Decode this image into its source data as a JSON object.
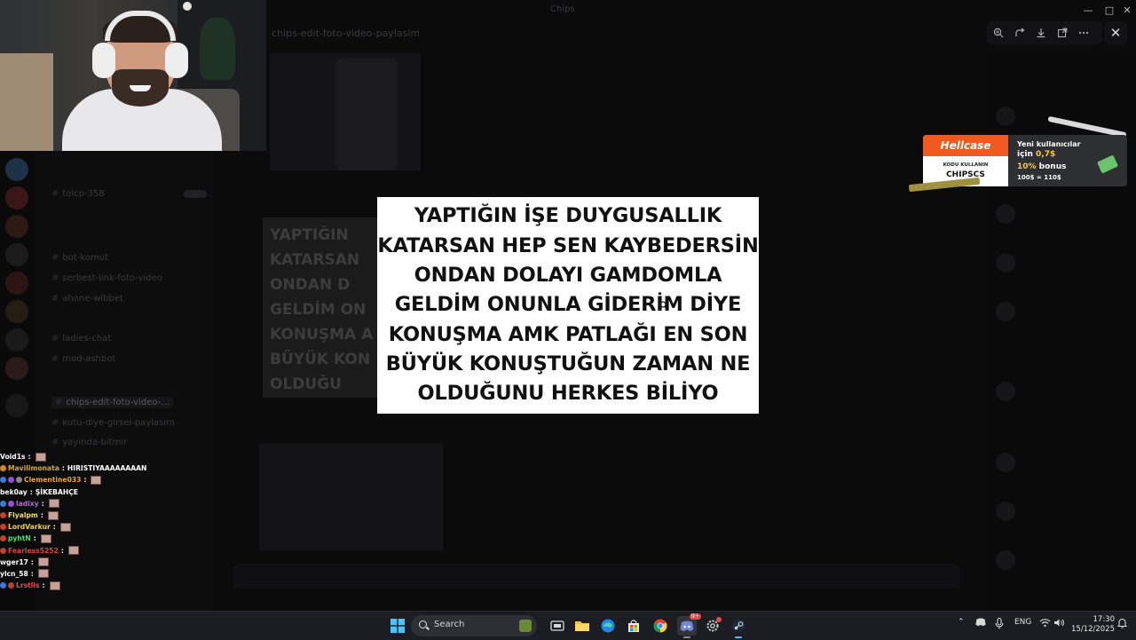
{
  "window": {
    "title": "Chips",
    "minimize_glyph": "—",
    "maximize_glyph": "□",
    "close_glyph": "✕"
  },
  "background_app": {
    "channel_header": "chips-edit-foto-video-paylasim",
    "channels": [
      {
        "label": "tolcp-358",
        "icon": "hash-icon"
      },
      {
        "label": "bot-komut",
        "icon": "hash-icon"
      },
      {
        "label": "serbest-link-foto-video",
        "icon": "hash-icon"
      },
      {
        "label": "ahone-wibbet",
        "icon": "hash-icon"
      },
      {
        "label": "ladies-chat",
        "icon": "hash-icon"
      },
      {
        "label": "mod-ashbot",
        "icon": "hash-icon"
      },
      {
        "label": "chips-edit-foto-video-...",
        "icon": "hash-icon",
        "active": true
      },
      {
        "label": "kutu-diye-girsel-paylasim",
        "icon": "hash-icon"
      },
      {
        "label": "yayinda-bitmir",
        "icon": "hash-icon"
      }
    ],
    "preview_card_lines": [
      "YAPTIĞIN",
      "KATARSAN",
      "ONDAN D",
      "GELDİM ON",
      "KONUŞMA A",
      "BÜYÜK KON",
      "OLDUĞU"
    ]
  },
  "image_viewer": {
    "toolbar_icons": [
      "zoom-in-icon",
      "rotate-icon",
      "download-icon",
      "open-external-icon",
      "more-icon"
    ],
    "close_glyph": "✕",
    "quote_lines": [
      "YAPTIĞIN İŞE DUYGUSALLIK",
      "KATARSAN HEP SEN KAYBEDERSİN",
      "ONDAN DOLAYI GAMDOMLA",
      "GELDİM ONUNLA GİDERİM DİYE",
      "KONUŞMA AMK PATLAĞI EN SON",
      "BÜYÜK KONUŞTUĞUN ZAMAN NE",
      "OLDUĞUNU HERKES BİLİYO"
    ]
  },
  "chat": {
    "messages": [
      {
        "user": "Void1s",
        "color": "#ffffff",
        "message": "",
        "emote": true
      },
      {
        "user": "Mavilimonata",
        "color": "#d8a63a",
        "message": "HIRISTIYAAAAAAAAN",
        "emote": false
      },
      {
        "user": "Clementine033",
        "color": "#f0a030",
        "message": "",
        "emote": true
      },
      {
        "user": "bek0ay",
        "color": "#ffffff",
        "message": "ŞİKEBAHÇE",
        "emote": false
      },
      {
        "user": "ladixy",
        "color": "#b86ad6",
        "message": "",
        "emote": true
      },
      {
        "user": "Flyalpm",
        "color": "#f0e060",
        "message": "",
        "emote": true
      },
      {
        "user": "LordVarkur",
        "color": "#f0d040",
        "message": "",
        "emote": true
      },
      {
        "user": "pyhtN",
        "color": "#40e070",
        "message": "",
        "emote": true
      },
      {
        "user": "Fearless5252",
        "color": "#e04040",
        "message": "",
        "emote": true
      },
      {
        "user": "wger17",
        "color": "#ffffff",
        "message": "",
        "emote": true
      },
      {
        "user": "ylcn_58",
        "color": "#ffffff",
        "message": "",
        "emote": true
      },
      {
        "user": "Lrstlis",
        "color": "#e05050",
        "message": "",
        "emote": true
      }
    ]
  },
  "ad": {
    "brand": "Hellcase",
    "code_label": "KODU KULLANIN",
    "code": "CHIPSCS",
    "line1": "Yeni kullanıcılar",
    "line2_prefix": "için ",
    "line2_value": "0,7$",
    "line3_value": "10%",
    "line3_suffix": " bonus",
    "line4": "100$ = 110$",
    "accent": "#f2591e"
  },
  "taskbar": {
    "search_placeholder": "Search",
    "apps": [
      "windows-start-icon",
      "file-explorer-icon",
      "edge-browser-icon",
      "store-icon",
      "chrome-icon",
      "discord-icon",
      "settings-icon",
      "steam-icon"
    ],
    "language": "ENG",
    "time": "17:30",
    "date": "15/12/2025",
    "discord_badge": "9+"
  }
}
